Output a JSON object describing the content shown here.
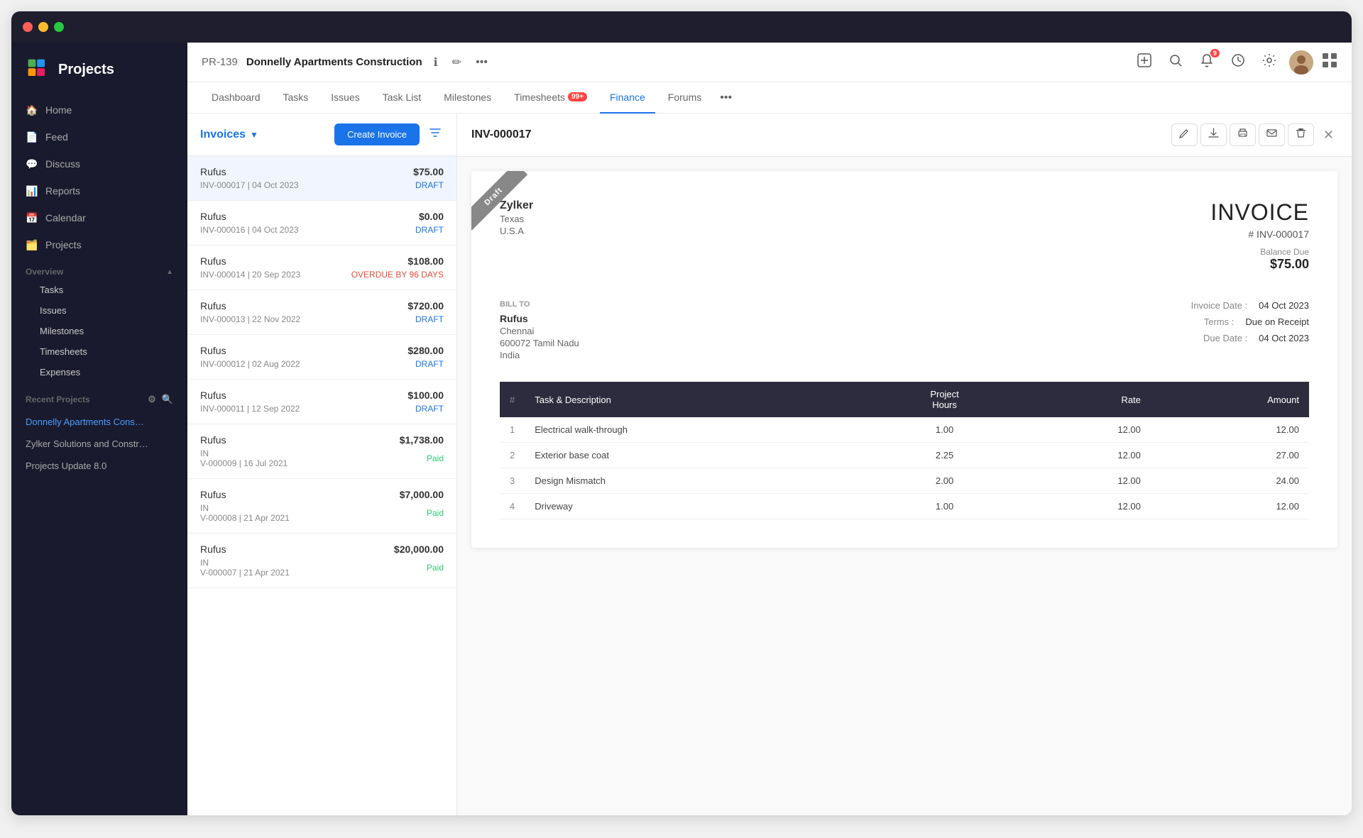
{
  "window": {
    "controls": {
      "close": "×",
      "min": "−",
      "max": "+"
    }
  },
  "sidebar": {
    "logo": {
      "text": "Projects"
    },
    "nav": [
      {
        "id": "home",
        "label": "Home",
        "icon": "🏠"
      },
      {
        "id": "feed",
        "label": "Feed",
        "icon": "📄"
      },
      {
        "id": "discuss",
        "label": "Discuss",
        "icon": "💬"
      },
      {
        "id": "reports",
        "label": "Reports",
        "icon": "📊"
      },
      {
        "id": "calendar",
        "label": "Calendar",
        "icon": "📅"
      },
      {
        "id": "projects",
        "label": "Projects",
        "icon": "🗂️"
      }
    ],
    "overview_section": {
      "label": "Overview",
      "items": [
        {
          "id": "tasks",
          "label": "Tasks"
        },
        {
          "id": "issues",
          "label": "Issues"
        },
        {
          "id": "milestones",
          "label": "Milestones"
        },
        {
          "id": "timesheets",
          "label": "Timesheets"
        },
        {
          "id": "expenses",
          "label": "Expenses"
        }
      ]
    },
    "recent_projects_section": {
      "label": "Recent Projects",
      "projects": [
        {
          "id": "donnelly",
          "label": "Donnelly Apartments Cons…",
          "active": true
        },
        {
          "id": "zylker",
          "label": "Zylker Solutions and Constr…"
        },
        {
          "id": "update",
          "label": "Projects Update 8.0"
        }
      ]
    }
  },
  "topbar": {
    "project_id": "PR-139",
    "project_name": "Donnelly Apartments Construction",
    "actions": {
      "info": "ℹ",
      "edit": "✏",
      "more": "•••"
    },
    "right": {
      "add": "+",
      "search": "🔍",
      "notifications": "🔔",
      "notification_count": "9",
      "clock": "⏱",
      "settings": "⚙",
      "grid": "⊞"
    }
  },
  "tabs": [
    {
      "id": "dashboard",
      "label": "Dashboard",
      "active": false
    },
    {
      "id": "tasks",
      "label": "Tasks",
      "active": false
    },
    {
      "id": "issues",
      "label": "Issues",
      "active": false
    },
    {
      "id": "tasklist",
      "label": "Task List",
      "active": false
    },
    {
      "id": "milestones",
      "label": "Milestones",
      "active": false
    },
    {
      "id": "timesheets",
      "label": "Timesheets",
      "active": false,
      "badge": "99+"
    },
    {
      "id": "finance",
      "label": "Finance",
      "active": true
    },
    {
      "id": "forums",
      "label": "Forums",
      "active": false
    }
  ],
  "invoice_list": {
    "header": "Invoices",
    "create_btn": "Create Invoice",
    "items": [
      {
        "id": "inv17",
        "client": "Rufus",
        "amount": "$75.00",
        "ref": "INV-000017 | 04 Oct 2023",
        "status": "DRAFT",
        "status_type": "draft",
        "active": true
      },
      {
        "id": "inv16",
        "client": "Rufus",
        "amount": "$0.00",
        "ref": "INV-000016 | 04 Oct 2023",
        "status": "DRAFT",
        "status_type": "draft",
        "active": false
      },
      {
        "id": "inv14",
        "client": "Rufus",
        "amount": "$108.00",
        "ref": "INV-000014 | 20 Sep 2023",
        "status": "OVERDUE BY 96 DAYS",
        "status_type": "overdue",
        "active": false
      },
      {
        "id": "inv13",
        "client": "Rufus",
        "amount": "$720.00",
        "ref": "INV-000013 | 22 Nov 2022",
        "status": "DRAFT",
        "status_type": "draft",
        "active": false
      },
      {
        "id": "inv12",
        "client": "Rufus",
        "amount": "$280.00",
        "ref": "INV-000012 | 02 Aug 2022",
        "status": "DRAFT",
        "status_type": "draft",
        "active": false
      },
      {
        "id": "inv11",
        "client": "Rufus",
        "amount": "$100.00",
        "ref": "INV-000011 | 12 Sep 2022",
        "status": "DRAFT",
        "status_type": "draft",
        "active": false
      },
      {
        "id": "inv9",
        "client": "Rufus",
        "amount": "$1,738.00",
        "ref": "IN\nV-000009 | 16 Jul 2021",
        "ref_line1": "IN",
        "ref_line2": "V-000009 | 16 Jul 2021",
        "status": "Paid",
        "status_type": "paid",
        "active": false
      },
      {
        "id": "inv8",
        "client": "Rufus",
        "amount": "$7,000.00",
        "ref_line1": "IN",
        "ref_line2": "V-000008 | 21 Apr 2021",
        "status": "Paid",
        "status_type": "paid",
        "active": false
      },
      {
        "id": "inv7",
        "client": "Rufus",
        "amount": "$20,000.00",
        "ref_line1": "IN",
        "ref_line2": "V-000007 | 21 Apr 2021",
        "status": "Paid",
        "status_type": "paid",
        "active": false
      }
    ]
  },
  "invoice_detail": {
    "number": "INV-000017",
    "ribbon": "Draft",
    "company": {
      "name": "Zylker",
      "address1": "Texas",
      "address2": "U.S.A"
    },
    "title": "INVOICE",
    "ref": "# INV-000017",
    "balance_due_label": "Balance Due",
    "balance_due": "$75.00",
    "bill_to_label": "Bill To",
    "bill_to": {
      "name": "Rufus",
      "address1": "Chennai",
      "address2": "600072 Tamil Nadu",
      "address3": "India"
    },
    "invoice_date_label": "Invoice Date :",
    "invoice_date": "04 Oct 2023",
    "terms_label": "Terms :",
    "terms": "Due on Receipt",
    "due_date_label": "Due Date :",
    "due_date": "04 Oct 2023",
    "table": {
      "headers": [
        "#",
        "Task & Description",
        "Project Hours",
        "Rate",
        "Amount"
      ],
      "rows": [
        {
          "num": "1",
          "task": "Electrical walk-through",
          "hours": "1.00",
          "rate": "12.00",
          "amount": "12.00"
        },
        {
          "num": "2",
          "task": "Exterior base coat",
          "hours": "2.25",
          "rate": "12.00",
          "amount": "27.00"
        },
        {
          "num": "3",
          "task": "Design Mismatch",
          "hours": "2.00",
          "rate": "12.00",
          "amount": "24.00"
        },
        {
          "num": "4",
          "task": "Driveway",
          "hours": "1.00",
          "rate": "12.00",
          "amount": "12.00"
        }
      ]
    }
  }
}
